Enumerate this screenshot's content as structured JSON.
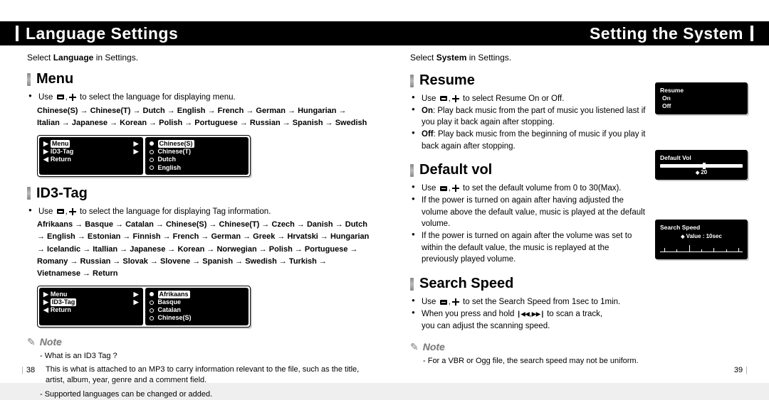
{
  "left": {
    "headerTitle": "Language Settings",
    "subtext_pre": "Select ",
    "subtext_bold": "Language",
    "subtext_post": " in Settings.",
    "menu": {
      "title": "Menu",
      "bullet1_pre": "Use ",
      "bullet1_post": " to select the language for displaying menu.",
      "chain": "Chinese(S) → Chinese(T) → Dutch → English → French → German → Hungarian → Italian → Japanese → Korean → Polish → Portuguese → Russian → Spanish → Swedish",
      "lcdLeft": {
        "r1": "Menu",
        "r2": "ID3-Tag",
        "r3": "Return"
      },
      "lcdRight": {
        "r1": "Chinese(S)",
        "r2": "Chinese(T)",
        "r3": "Dutch",
        "r4": "English"
      }
    },
    "id3": {
      "title": "ID3-Tag",
      "bullet1_pre": "Use ",
      "bullet1_post": " to select the language for displaying Tag information.",
      "chain": "Afrikaans → Basque → Catalan → Chinese(S) → Chinese(T) → Czech → Danish → Dutch → English → Estonian → Finnish → French → German → Greek → Hrvatski → Hungarian → Icelandic → Itallian → Japanese → Korean → Norwegian → Polish → Portuguese → Romany → Russian → Slovak → Slovene → Spanish → Swedish → Turkish → Vietnamese → Return",
      "lcdLeft": {
        "r1": "Menu",
        "r2": "ID3-Tag",
        "r3": "Return"
      },
      "lcdRight": {
        "r1": "Afrikaans",
        "r2": "Basque",
        "r3": "Catalan",
        "r4": "Chinese(S)"
      }
    },
    "noteLabel": "Note",
    "note1": "- What is an ID3 Tag ?",
    "note2": "This is what is attached to an MP3 to carry information relevant to the file, such as the title, artist, album, year, genre and a comment field.",
    "note3": "- Supported languages can be changed or added.",
    "pageNum": "38"
  },
  "right": {
    "headerTitle": "Setting the System",
    "subtext_pre": "Select ",
    "subtext_bold": "System",
    "subtext_post": " in Settings.",
    "resume": {
      "title": "Resume",
      "b1_pre": "Use ",
      "b1_post": " to select Resume On or Off.",
      "b2_pre": "On",
      "b2_post": ": Play back music from the part of music you listened last if you play it back again after stopping.",
      "b3_pre": "Off",
      "b3_post": ": Play back music from the beginning of music if you play it back again after stopping.",
      "lcd": {
        "title": "Resume",
        "opt1": "On",
        "opt2": "Off"
      }
    },
    "default_vol": {
      "title": "Default vol",
      "b1_pre": "Use ",
      "b1_post": " to set the default volume from 0 to 30(Max).",
      "b2": "If the power is turned on again after having adjusted the volume above the default value, music is played at the default volume.",
      "b3": "If the power is turned on again after the volume was set to within the default value, the music is replayed at the previously played volume.",
      "lcd": {
        "title": "Default Vol",
        "val": "20"
      }
    },
    "search_speed": {
      "title": "Search Speed",
      "b1_pre": "Use ",
      "b1_post": " to set the Search Speed from 1sec to 1min.",
      "b2_pre": "When you press and hold ",
      "b2_mid": " to scan a track,",
      "b2_post": "you can adjust the scanning speed.",
      "lcd": {
        "title": "Search Speed",
        "val": "Value : 10sec"
      }
    },
    "noteLabel": "Note",
    "note1": "- For a VBR or Ogg file, the search speed may not be uniform.",
    "pageNum": "39"
  }
}
